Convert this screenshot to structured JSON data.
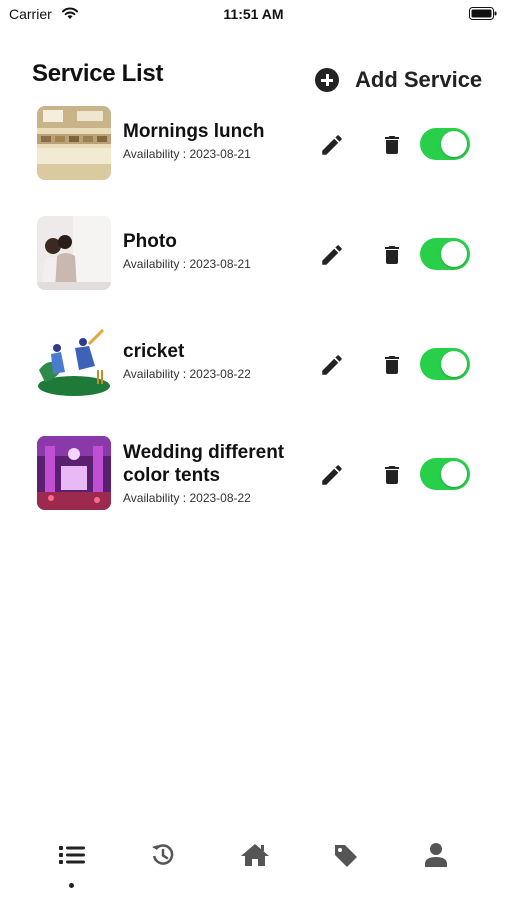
{
  "status_bar": {
    "carrier": "Carrier",
    "time": "11:51 AM"
  },
  "header": {
    "title": "Service List",
    "add_service_label": "Add Service"
  },
  "services": [
    {
      "name": "Mornings lunch",
      "availability": "Availability : 2023-08-21",
      "enabled": true,
      "image": "buffet-photo"
    },
    {
      "name": "Photo",
      "availability": "Availability : 2023-08-21",
      "enabled": true,
      "image": "couple-photo"
    },
    {
      "name": "cricket",
      "availability": "Availability : 2023-08-22",
      "enabled": true,
      "image": "cricket-illustration"
    },
    {
      "name": "Wedding different color tents",
      "availability": "Availability : 2023-08-22",
      "enabled": true,
      "image": "wedding-tent-photo"
    }
  ],
  "tab_bar": {
    "tabs": [
      "list-icon",
      "history-icon",
      "home-icon",
      "tag-icon",
      "profile-icon"
    ],
    "active_tab": "list-icon"
  },
  "colors": {
    "toggle_on": "#28d04a",
    "icon_dark": "#222222"
  }
}
